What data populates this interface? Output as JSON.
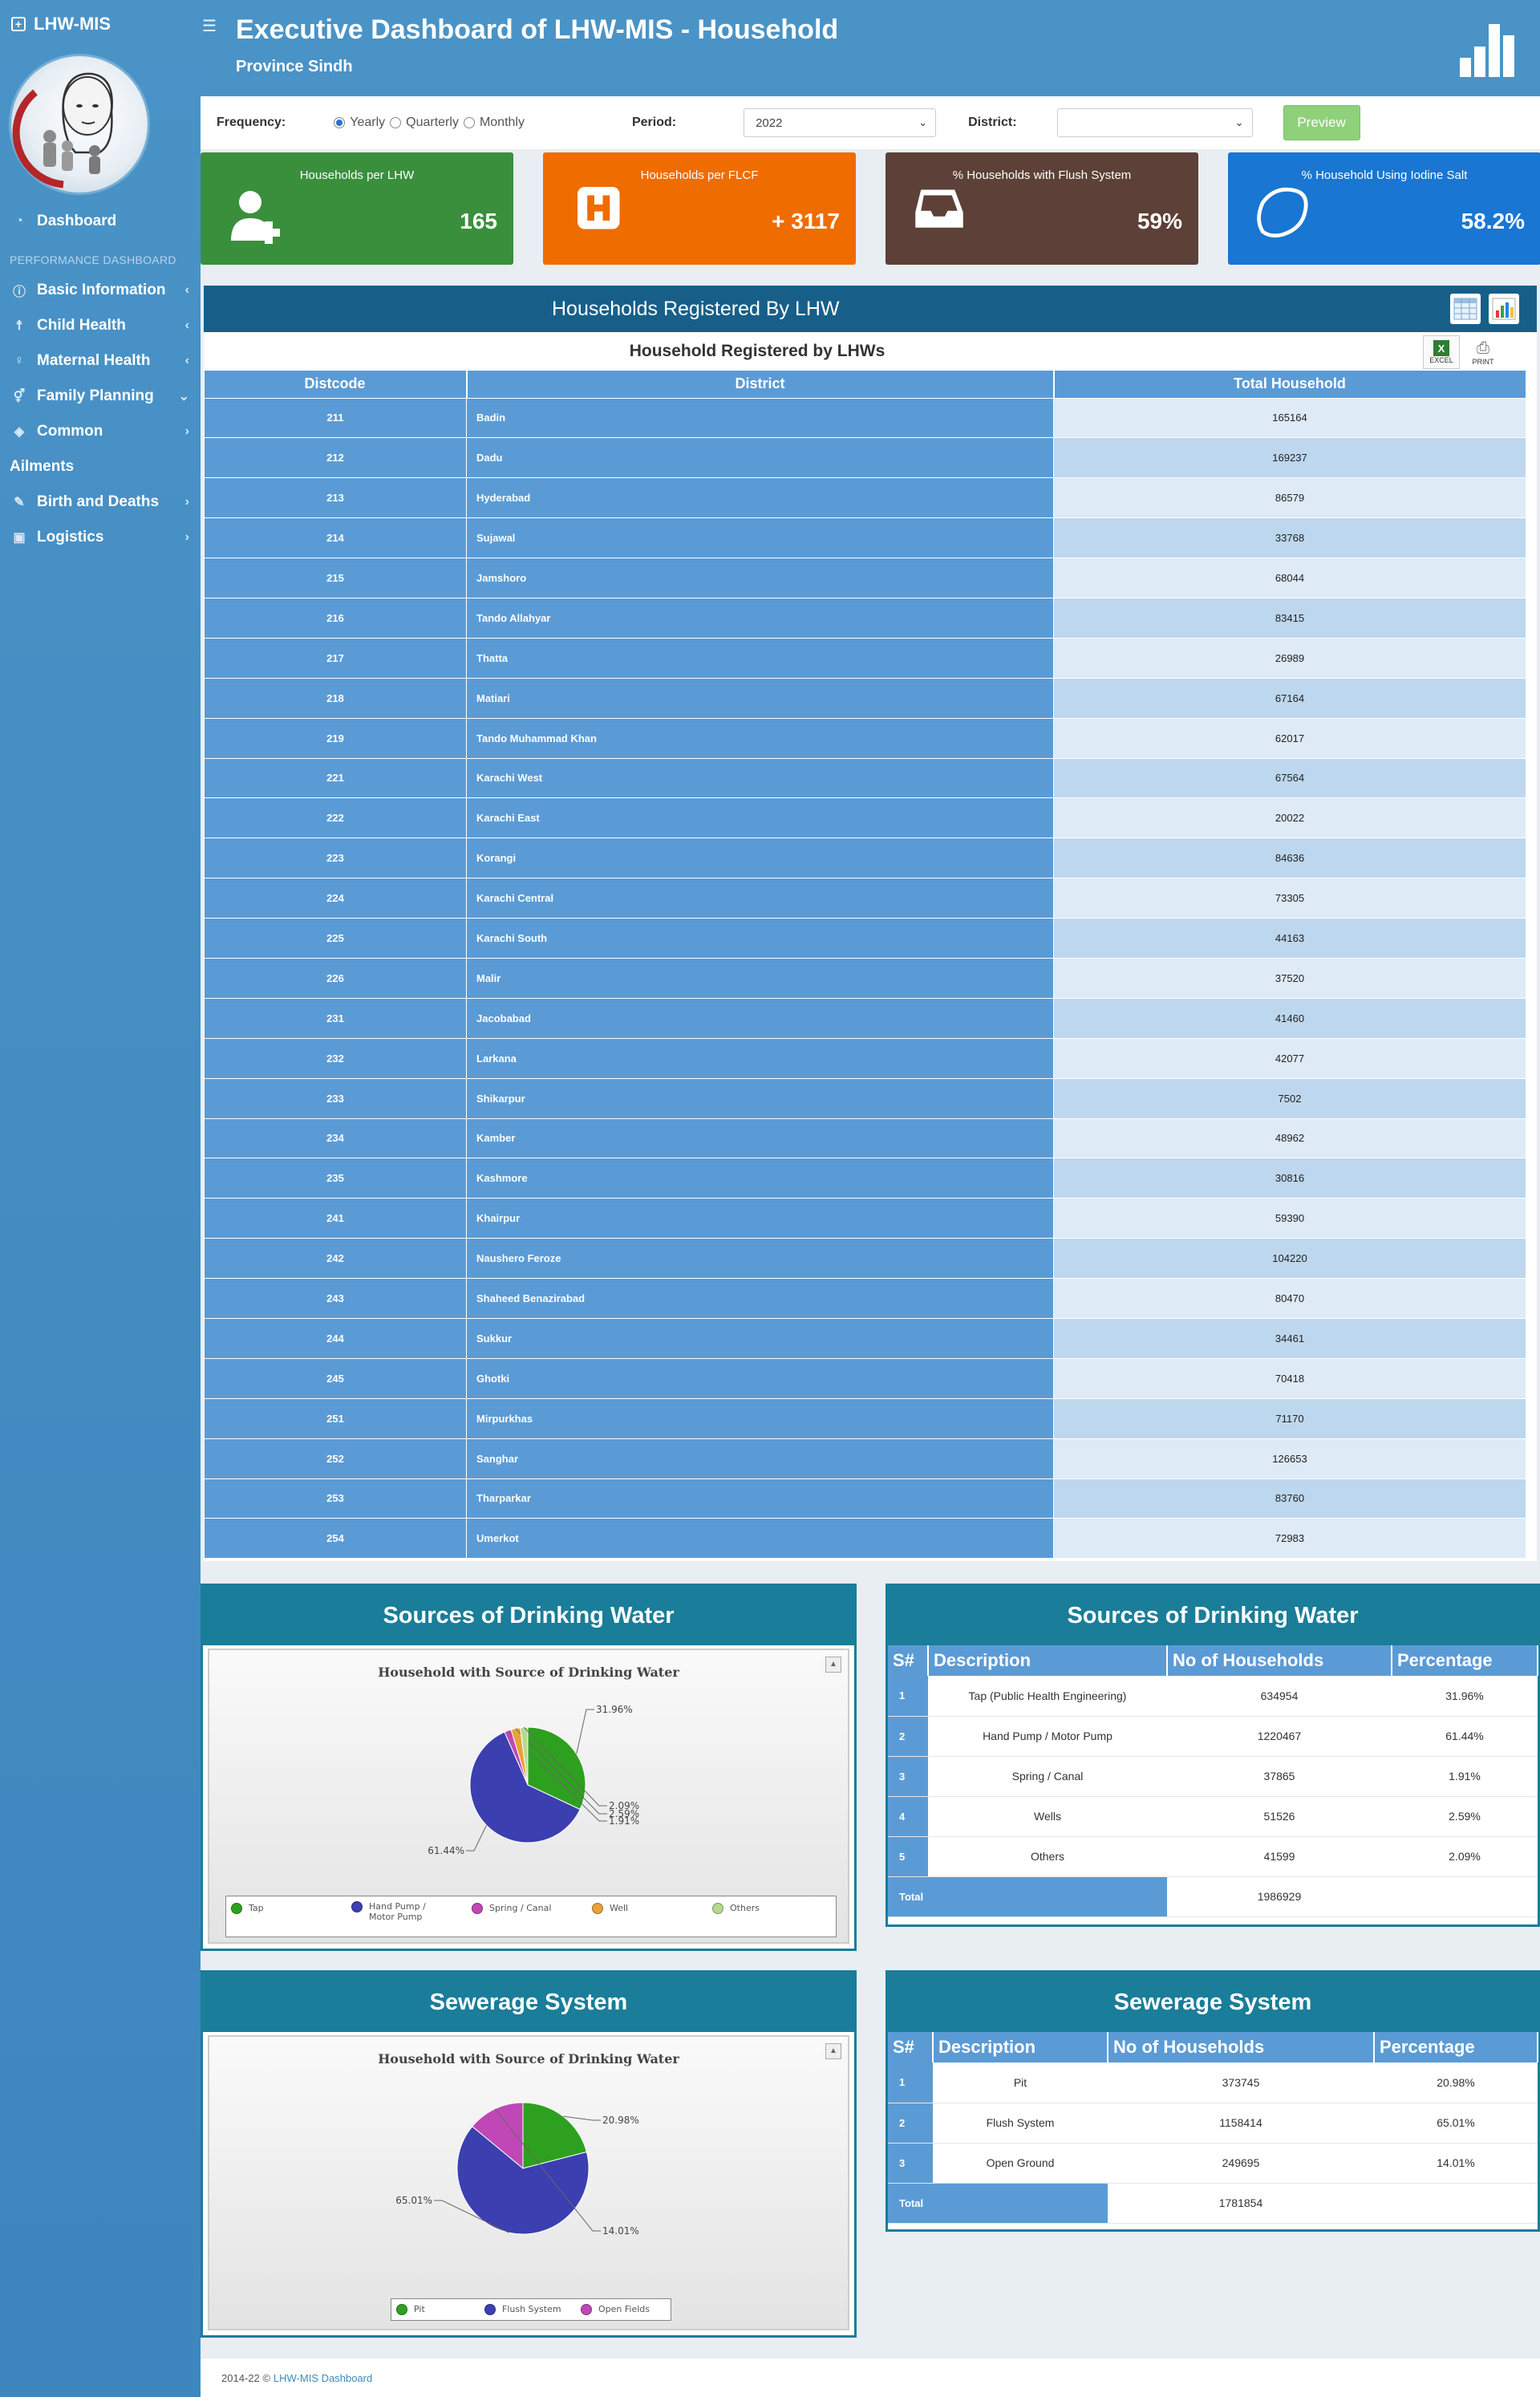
{
  "app": {
    "brand": "LHW-MIS"
  },
  "sidebar": {
    "dashboard_label": "Dashboard",
    "section_heading": "PERFORMANCE DASHBOARD",
    "items": [
      {
        "label": "Basic Information",
        "icon": "info-icon"
      },
      {
        "label": "Child Health",
        "icon": "child-icon"
      },
      {
        "label": "Maternal Health",
        "icon": "female-icon"
      },
      {
        "label": "Family Planning",
        "icon": "venus-mars-icon"
      },
      {
        "label": "Common",
        "icon": "tag-icon"
      }
    ],
    "ailments_label": "Ailments",
    "items2": [
      {
        "label": "Birth and Deaths",
        "icon": "wrench-icon"
      },
      {
        "label": "Logistics",
        "icon": "briefcase-icon"
      }
    ]
  },
  "header": {
    "title": "Executive Dashboard of LHW-MIS - Household",
    "subtitle": "Province Sindh"
  },
  "filters": {
    "frequency_label": "Frequency:",
    "options": [
      "Yearly",
      "Quarterly",
      "Monthly"
    ],
    "selected": "Yearly",
    "period_label": "Period:",
    "period_value": "2022",
    "district_label": "District:",
    "district_value": "",
    "preview_label": "Preview"
  },
  "kpis": [
    {
      "label": "Households per LHW",
      "value": "165",
      "color": "#3a8f3d"
    },
    {
      "label": "Households per FLCF",
      "value": "+ 3117",
      "color": "#ef6c00"
    },
    {
      "label": "% Households with Flush System",
      "value": "59%",
      "color": "#5d4037"
    },
    {
      "label": "% Household Using Iodine Salt",
      "value": "58.2%",
      "color": "#1976d2"
    }
  ],
  "households": {
    "panel_title": "Households Registered By LHW",
    "table_title": "Household Registered by LHWs",
    "excel_label": "EXCEL",
    "print_label": "PRINT",
    "columns": [
      "Distcode",
      "District",
      "Total Household"
    ],
    "rows": [
      [
        "211",
        "Badin",
        "165164"
      ],
      [
        "212",
        "Dadu",
        "169237"
      ],
      [
        "213",
        "Hyderabad",
        "86579"
      ],
      [
        "214",
        "Sujawal",
        "33768"
      ],
      [
        "215",
        "Jamshoro",
        "68044"
      ],
      [
        "216",
        "Tando Allahyar",
        "83415"
      ],
      [
        "217",
        "Thatta",
        "26989"
      ],
      [
        "218",
        "Matiari",
        "67164"
      ],
      [
        "219",
        "Tando Muhammad Khan",
        "62017"
      ],
      [
        "221",
        "Karachi West",
        "67564"
      ],
      [
        "222",
        "Karachi East",
        "20022"
      ],
      [
        "223",
        "Korangi",
        "84636"
      ],
      [
        "224",
        "Karachi Central",
        "73305"
      ],
      [
        "225",
        "Karachi South",
        "44163"
      ],
      [
        "226",
        "Malir",
        "37520"
      ],
      [
        "231",
        "Jacobabad",
        "41460"
      ],
      [
        "232",
        "Larkana",
        "42077"
      ],
      [
        "233",
        "Shikarpur",
        "7502"
      ],
      [
        "234",
        "Kamber",
        "48962"
      ],
      [
        "235",
        "Kashmore",
        "30816"
      ],
      [
        "241",
        "Khairpur",
        "59390"
      ],
      [
        "242",
        "Naushero Feroze",
        "104220"
      ],
      [
        "243",
        "Shaheed Benazirabad",
        "80470"
      ],
      [
        "244",
        "Sukkur",
        "34461"
      ],
      [
        "245",
        "Ghotki",
        "70418"
      ],
      [
        "251",
        "Mirpurkhas",
        "71170"
      ],
      [
        "252",
        "Sanghar",
        "126653"
      ],
      [
        "253",
        "Tharparkar",
        "83760"
      ],
      [
        "254",
        "Umerkot",
        "72983"
      ]
    ]
  },
  "water": {
    "panel_title": "Sources of Drinking Water",
    "chart_title": "Household with Source of Drinking Water",
    "chart_data": {
      "type": "pie",
      "title": "Household with Source of Drinking Water",
      "slices": [
        {
          "name": "Tap",
          "value": 31.96,
          "label": "31.96%",
          "color": "#2ea01f"
        },
        {
          "name": "Hand Pump / Motor Pump",
          "value": 61.44,
          "label": "61.44%",
          "color": "#3b3fb0"
        },
        {
          "name": "Spring / Canal",
          "value": 1.91,
          "label": "1.91%",
          "color": "#c048b6"
        },
        {
          "name": "Well",
          "value": 2.59,
          "label": "2.59%",
          "color": "#e8a338"
        },
        {
          "name": "Others",
          "value": 2.09,
          "label": "2.09%",
          "color": "#b6d98f"
        }
      ],
      "legend": "bottom"
    },
    "legend_labels": [
      "Tap",
      "Hand Pump / Motor Pump",
      "Spring / Canal",
      "Well",
      "Others"
    ],
    "table_title": "Sources of Drinking Water",
    "columns": [
      "S#",
      "Description",
      "No of Households",
      "Percentage"
    ],
    "rows": [
      [
        "1",
        "Tap (Public Health Engineering)",
        "634954",
        "31.96%"
      ],
      [
        "2",
        "Hand Pump / Motor Pump",
        "1220467",
        "61.44%"
      ],
      [
        "3",
        "Spring / Canal",
        "37865",
        "1.91%"
      ],
      [
        "4",
        "Wells",
        "51526",
        "2.59%"
      ],
      [
        "5",
        "Others",
        "41599",
        "2.09%"
      ]
    ],
    "total_label": "Total",
    "total_value": "1986929"
  },
  "sewerage": {
    "panel_title": "Sewerage System",
    "chart_title": "Household with Source of Drinking Water",
    "chart_data": {
      "type": "pie",
      "title": "Household with Source of Drinking Water",
      "slices": [
        {
          "name": "Pit",
          "value": 20.98,
          "label": "20.98%",
          "color": "#2ea01f"
        },
        {
          "name": "Flush System",
          "value": 65.01,
          "label": "65.01%",
          "color": "#3b3fb0"
        },
        {
          "name": "Open Fields",
          "value": 14.01,
          "label": "14.01%",
          "color": "#c048b6"
        }
      ],
      "legend": "bottom"
    },
    "legend_labels": [
      "Pit",
      "Flush System",
      "Open Fields"
    ],
    "table_title": "Sewerage System",
    "columns": [
      "S#",
      "Description",
      "No of Households",
      "Percentage"
    ],
    "rows": [
      [
        "1",
        "Pit",
        "373745",
        "20.98%"
      ],
      [
        "2",
        "Flush System",
        "1158414",
        "65.01%"
      ],
      [
        "3",
        "Open Ground",
        "249695",
        "14.01%"
      ]
    ],
    "total_label": "Total",
    "total_value": "1781854"
  },
  "footer": {
    "text": "2014-22 ©",
    "link": "LHW-MIS Dashboard"
  }
}
